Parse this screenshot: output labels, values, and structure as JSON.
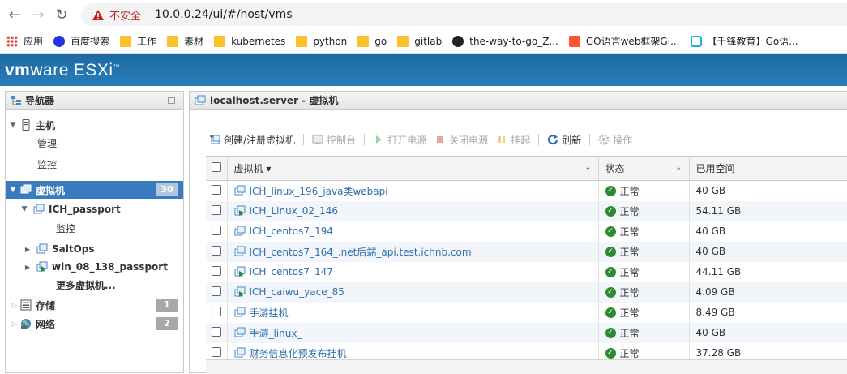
{
  "browser": {
    "security_label": "不安全",
    "url": "10.0.0.24/ui/#/host/vms",
    "bookmarks": [
      {
        "label": "应用",
        "icon": "apps-grid-icon"
      },
      {
        "label": "百度搜索",
        "icon": "baidu-paw-icon"
      },
      {
        "label": "工作",
        "icon": "folder-icon"
      },
      {
        "label": "素材",
        "icon": "folder-icon"
      },
      {
        "label": "kubernetes",
        "icon": "folder-icon"
      },
      {
        "label": "python",
        "icon": "folder-icon"
      },
      {
        "label": "go",
        "icon": "folder-icon"
      },
      {
        "label": "gitlab",
        "icon": "folder-icon"
      },
      {
        "label": "the-way-to-go_Z...",
        "icon": "github-icon"
      },
      {
        "label": "GO语言web框架Gi...",
        "icon": "csdn-icon"
      },
      {
        "label": "【千锋教育】Go语...",
        "icon": "bilibili-icon"
      }
    ]
  },
  "app": {
    "brand_vm": "vm",
    "brand_ware": "ware",
    "brand_product": "ESXi",
    "brand_tm": "™"
  },
  "navigator": {
    "title": "导航器",
    "host": "主机",
    "host_children": [
      "管理",
      "监控"
    ],
    "vms": "虚拟机",
    "vms_count": "30",
    "vm_passport": "ICH_passport",
    "vm_passport_child": "监控",
    "saltops": "SaltOps",
    "win": "win_08_138_passport",
    "more_vms": "更多虚拟机...",
    "storage": "存储",
    "storage_count": "1",
    "network": "网络",
    "network_count": "2"
  },
  "main": {
    "title": "localhost.server - 虚拟机",
    "toolbar": {
      "create": "创建/注册虚拟机",
      "console": "控制台",
      "power_on": "打开电源",
      "power_off": "关闭电源",
      "suspend": "挂起",
      "refresh": "刷新",
      "actions": "操作"
    },
    "columns": {
      "name": "虚拟机 ▾",
      "status": "状态",
      "used": "已用空间"
    },
    "rows": [
      {
        "name": "ICH_linux_196_java类webapi",
        "status": "正常",
        "used": "40 GB",
        "powered": false
      },
      {
        "name": "ICH_Linux_02_146",
        "status": "正常",
        "used": "54.11 GB",
        "powered": true
      },
      {
        "name": "ICH_centos7_194",
        "status": "正常",
        "used": "40 GB",
        "powered": false
      },
      {
        "name": "ICH_centos7_164_.net后端_api.test.ichnb.com",
        "status": "正常",
        "used": "40 GB",
        "powered": false
      },
      {
        "name": "ICH_centos7_147",
        "status": "正常",
        "used": "44.11 GB",
        "powered": true
      },
      {
        "name": "ICH_caiwu_yace_85",
        "status": "正常",
        "used": "4.09 GB",
        "powered": true
      },
      {
        "name": "手游挂机",
        "status": "正常",
        "used": "8.49 GB",
        "powered": false
      },
      {
        "name": "手游_linux_",
        "status": "正常",
        "used": "40 GB",
        "powered": false
      },
      {
        "name": "财务信息化预发布挂机",
        "status": "正常",
        "used": "37.28 GB",
        "powered": false
      }
    ]
  }
}
